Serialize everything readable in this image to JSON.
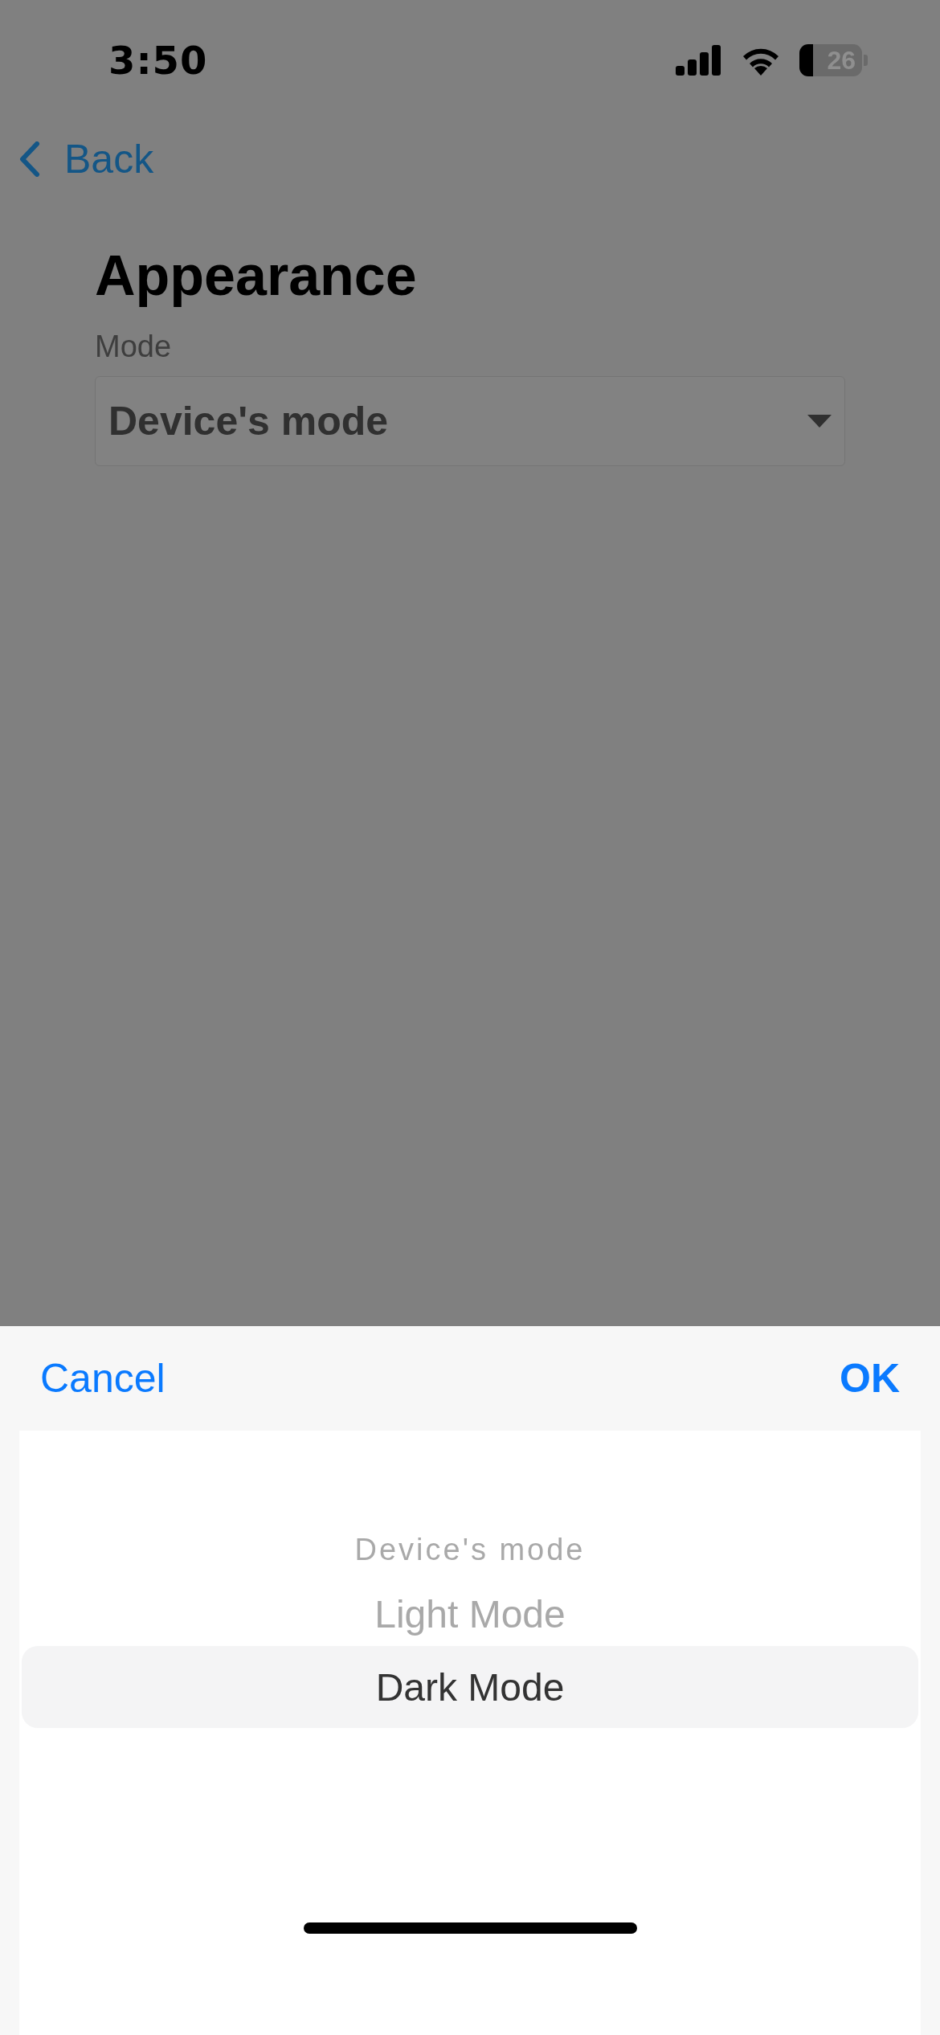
{
  "status_bar": {
    "time": "3:50",
    "battery": "26"
  },
  "nav": {
    "back": "Back"
  },
  "title": "Appearance",
  "field": {
    "label": "Mode",
    "value": "Device's mode"
  },
  "picker": {
    "cancel": "Cancel",
    "ok": "OK",
    "options": [
      {
        "label": "Device's mode",
        "selected": false
      },
      {
        "label": "Light Mode",
        "selected": false
      },
      {
        "label": "Dark Mode",
        "selected": true
      }
    ]
  }
}
